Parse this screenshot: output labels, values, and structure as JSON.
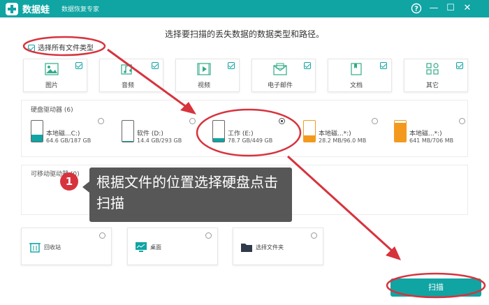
{
  "titlebar": {
    "app_name": "数据蛙",
    "subtitle": "数据恢复专家",
    "help_icon": "?",
    "minimize_icon": "—",
    "restore_icon": "☐",
    "close_icon": "✕"
  },
  "prompt": "选择要扫描的丢失数据的数据类型和路径。",
  "select_all": {
    "label": "选择所有文件类型",
    "checked": true
  },
  "file_types": [
    {
      "label": "图片",
      "icon": "image-icon",
      "checked": true
    },
    {
      "label": "音频",
      "icon": "audio-icon",
      "checked": true
    },
    {
      "label": "视频",
      "icon": "video-icon",
      "checked": true
    },
    {
      "label": "电子邮件",
      "icon": "email-icon",
      "checked": true
    },
    {
      "label": "文档",
      "icon": "document-icon",
      "checked": true
    },
    {
      "label": "其它",
      "icon": "other-icon",
      "checked": true
    }
  ],
  "hard_drives": {
    "title": "硬盘驱动器 (6)",
    "drives": [
      {
        "name": "本地磁...C:)",
        "size": "64.6 GB/187 GB",
        "fill": 0.35,
        "color": "#10a4a3",
        "selected": false
      },
      {
        "name": "软件 (D:)",
        "size": "14.4 GB/293 GB",
        "fill": 0.05,
        "color": "#10a4a3",
        "selected": false
      },
      {
        "name": "工作 (E:)",
        "size": "78.7 GB/449 GB",
        "fill": 0.18,
        "color": "#10a4a3",
        "selected": true
      },
      {
        "name": "本地磁...*:)",
        "size": "28.2 MB/96.0 MB",
        "fill": 0.3,
        "color": "#f39a1e",
        "selected": false
      },
      {
        "name": "本地磁...*:)",
        "size": "641 MB/706 MB",
        "fill": 0.9,
        "color": "#f39a1e",
        "selected": false
      }
    ]
  },
  "removable": {
    "title": "可移动驱动器 (0)"
  },
  "locations": [
    {
      "label": "回收站",
      "icon": "trash-icon"
    },
    {
      "label": "桌面",
      "icon": "desktop-icon"
    },
    {
      "label": "选择文件夹",
      "icon": "folder-icon"
    }
  ],
  "tooltip": {
    "step": "1",
    "text": "根据文件的位置选择硬盘点击扫描"
  },
  "scan_button": "扫描",
  "colors": {
    "accent": "#10a4a3",
    "annotation_red": "#d7333d",
    "removable_orange": "#f39a1e"
  }
}
